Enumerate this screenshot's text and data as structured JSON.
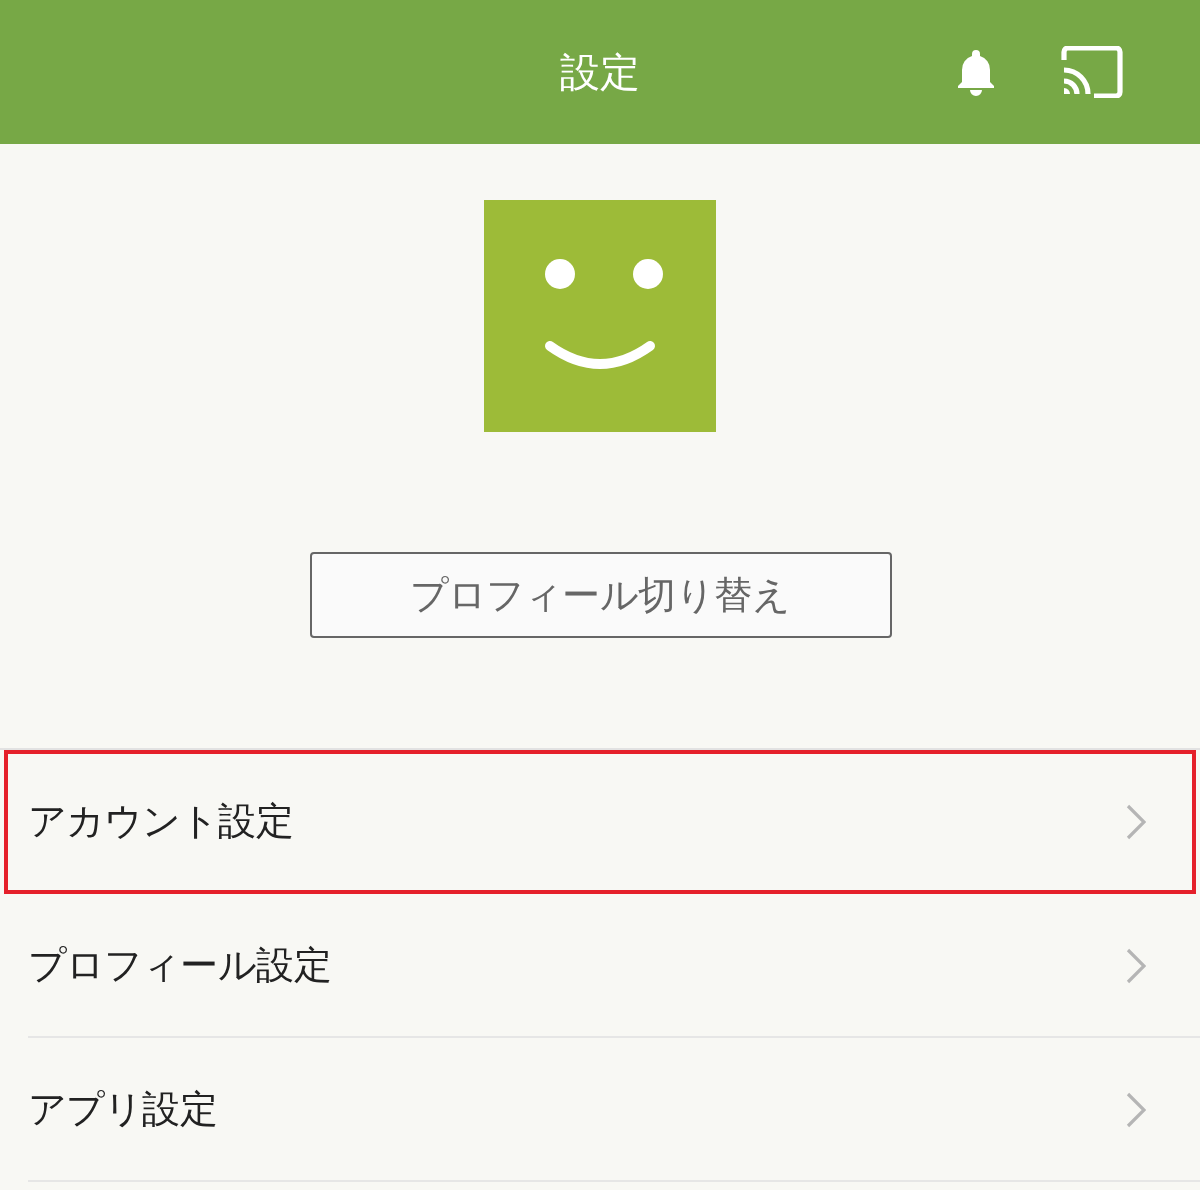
{
  "header": {
    "title": "設定"
  },
  "profile": {
    "switch_button": "プロフィール切り替え"
  },
  "menu": [
    {
      "label": "アカウント設定",
      "highlighted": true
    },
    {
      "label": "プロフィール設定",
      "highlighted": false
    },
    {
      "label": "アプリ設定",
      "highlighted": false
    }
  ]
}
